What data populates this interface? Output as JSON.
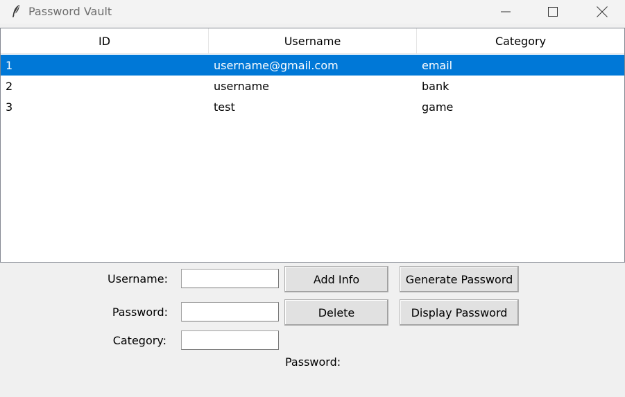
{
  "window": {
    "title": "Password Vault"
  },
  "table": {
    "columns": [
      "ID",
      "Username",
      "Category"
    ],
    "rows": [
      {
        "id": "1",
        "username": "username@gmail.com",
        "category": "email",
        "selected": true
      },
      {
        "id": "2",
        "username": "username",
        "category": "bank",
        "selected": false
      },
      {
        "id": "3",
        "username": "test",
        "category": "game",
        "selected": false
      }
    ]
  },
  "form": {
    "username_label": "Username:",
    "password_label": "Password:",
    "category_label": "Category:",
    "username_value": "",
    "password_value": "",
    "category_value": "",
    "password_display_label": "Password:"
  },
  "buttons": {
    "add_info": "Add Info",
    "delete": "Delete",
    "generate_password": "Generate Password",
    "display_password": "Display Password"
  },
  "colors": {
    "selection": "#0078d7",
    "window_bg": "#f0f0f0"
  }
}
